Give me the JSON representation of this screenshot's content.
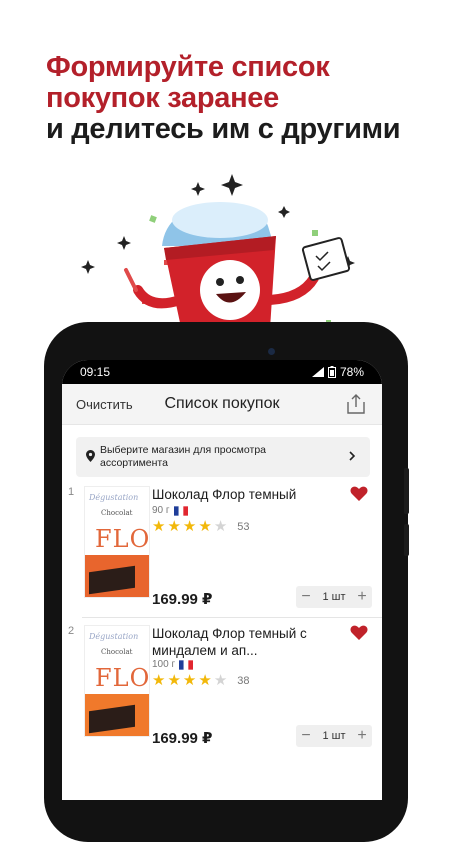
{
  "promo": {
    "line1": "Формируйте список",
    "line2": "покупок заранее",
    "line3": "и делитесь им с другими"
  },
  "status": {
    "time": "09:15",
    "battery": "78%"
  },
  "nav": {
    "clear_label": "Очистить",
    "title": "Список покупок"
  },
  "store_bar": {
    "text": "Выберите магазин для просмотра ассортимента"
  },
  "items": [
    {
      "index": "1",
      "pack_brand": "Dégustation",
      "pack_sub": "Chocolat",
      "pack_logo": "FLOR",
      "name": "Шоколад Флор темный",
      "weight": "90 г",
      "rating": 4,
      "rating_count": "53",
      "price": "169.99 ₽",
      "qty": "1 шт",
      "favorite": true
    },
    {
      "index": "2",
      "pack_brand": "Dégustation",
      "pack_sub": "Chocolat",
      "pack_logo": "FLOR",
      "name": "Шоколад Флор темный с миндалем и ап...",
      "weight": "100 г",
      "rating": 4,
      "rating_count": "38",
      "price": "169.99 ₽",
      "qty": "1 шт",
      "favorite": true
    }
  ],
  "colors": {
    "brand_red": "#b3202a",
    "star": "#f2b80a",
    "heart": "#c0222a"
  }
}
